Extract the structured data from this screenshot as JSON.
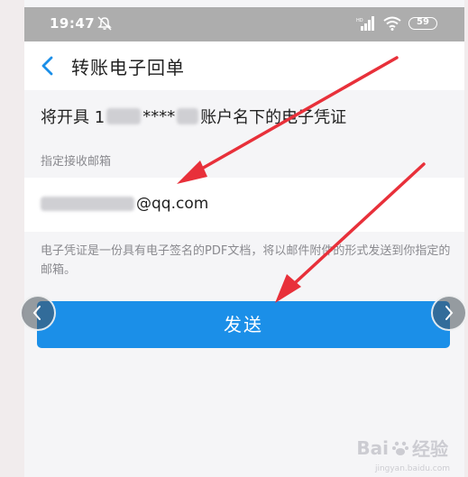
{
  "status_bar": {
    "time": "19:47",
    "battery": "59",
    "icons": [
      "mute-icon",
      "signal-icon",
      "wifi-icon",
      "battery-icon"
    ]
  },
  "nav": {
    "back_icon": "chevron-left-icon",
    "title": "转账电子回单"
  },
  "header": {
    "prefix": "将开具 1",
    "mask": "****",
    "suffix": "账户名下的电子凭证"
  },
  "email_section": {
    "label": "指定接收邮箱",
    "email_suffix": "@qq.com"
  },
  "info": {
    "text": "电子凭证是一份具有电子签名的PDF文档，将以邮件附件的形式发送到你指定的邮箱。"
  },
  "send_button": {
    "label": "发送"
  },
  "watermark": {
    "brand": "Bai",
    "brand_tail": "经验",
    "sub": "jingyan.baidu.com"
  },
  "colors": {
    "accent": "#1b8fe8",
    "arrow": "#e8303a",
    "status_bar": "#adadad"
  }
}
